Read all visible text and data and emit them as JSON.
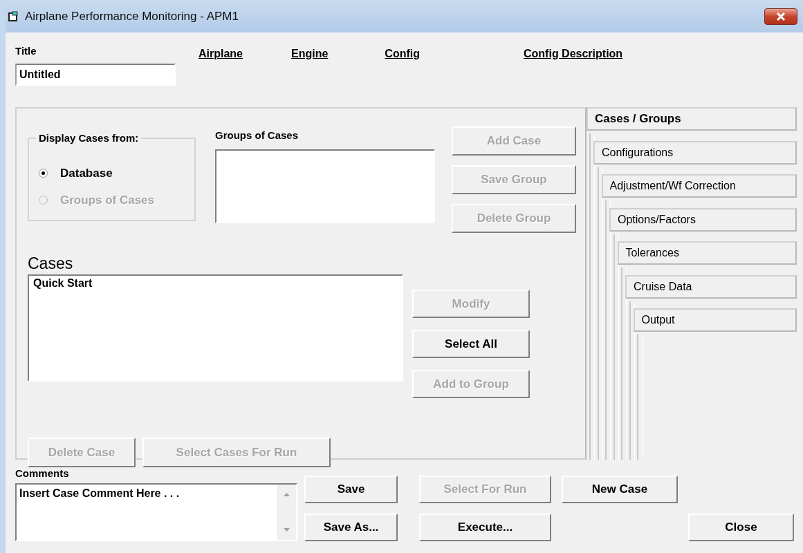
{
  "window": {
    "title": "Airplane Performance Monitoring - APM1"
  },
  "title_label": "Title",
  "title_field": {
    "value": "Untitled"
  },
  "column_headers": [
    "Airplane",
    "Engine",
    "Config",
    "Config Description"
  ],
  "display_group": {
    "label": "Display Cases from:",
    "options": [
      {
        "label": "Database",
        "selected": true,
        "disabled": false
      },
      {
        "label": "Groups of Cases",
        "selected": false,
        "disabled": true
      }
    ]
  },
  "groups_of_cases": {
    "label": "Groups of Cases"
  },
  "group_buttons": [
    {
      "label": "Add Case",
      "disabled": true
    },
    {
      "label": "Save Group",
      "disabled": true
    },
    {
      "label": "Delete Group",
      "disabled": true
    }
  ],
  "cases": {
    "label": "Cases",
    "items": [
      {
        "label": "Quick Start"
      }
    ]
  },
  "case_buttons": [
    {
      "label": "Modify",
      "disabled": true
    },
    {
      "label": "Select All",
      "disabled": false
    },
    {
      "label": "Add to Group",
      "disabled": true
    }
  ],
  "run_buttons": [
    {
      "label": "Delete Case",
      "disabled": true
    },
    {
      "label": "Select Cases For Run",
      "disabled": true
    }
  ],
  "tabs": [
    {
      "label": "Cases / Groups",
      "selected": true
    },
    {
      "label": "Configurations",
      "selected": false
    },
    {
      "label": "Adjustment/Wf Correction",
      "selected": false
    },
    {
      "label": "Options/Factors",
      "selected": false
    },
    {
      "label": "Tolerances",
      "selected": false
    },
    {
      "label": "Cruise Data",
      "selected": false
    },
    {
      "label": "Output",
      "selected": false
    }
  ],
  "comments": {
    "label": "Comments",
    "value": "Insert Case Comment Here . . ."
  },
  "bottom_buttons": [
    [
      {
        "label": "Save",
        "disabled": false
      },
      {
        "label": "Select For Run",
        "disabled": true
      },
      {
        "label": "New Case",
        "disabled": false
      }
    ],
    [
      {
        "label": "Save As...",
        "disabled": false
      },
      {
        "label": "Execute...",
        "disabled": false
      },
      {
        "label": "Close",
        "disabled": false
      }
    ]
  ]
}
